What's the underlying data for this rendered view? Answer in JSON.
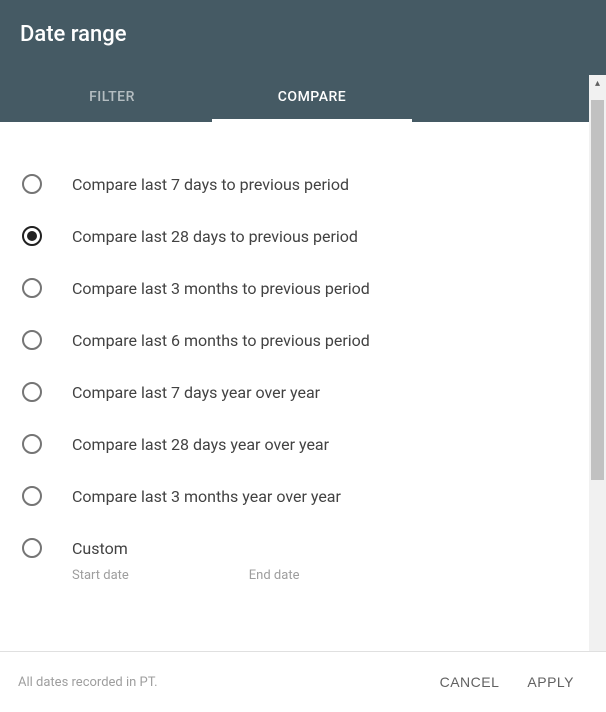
{
  "title": "Date range",
  "tabs": {
    "filter": "FILTER",
    "compare": "COMPARE"
  },
  "options": [
    {
      "label": "Compare last 7 days to previous period",
      "selected": false
    },
    {
      "label": "Compare last 28 days to previous period",
      "selected": true
    },
    {
      "label": "Compare last 3 months to previous period",
      "selected": false
    },
    {
      "label": "Compare last 6 months to previous period",
      "selected": false
    },
    {
      "label": "Compare last 7 days year over year",
      "selected": false
    },
    {
      "label": "Compare last 28 days year over year",
      "selected": false
    },
    {
      "label": "Compare last 3 months year over year",
      "selected": false
    },
    {
      "label": "Custom",
      "selected": false
    }
  ],
  "custom": {
    "start_label": "Start date",
    "end_label": "End date"
  },
  "footer": {
    "note": "All dates recorded in PT.",
    "cancel": "CANCEL",
    "apply": "APPLY"
  }
}
